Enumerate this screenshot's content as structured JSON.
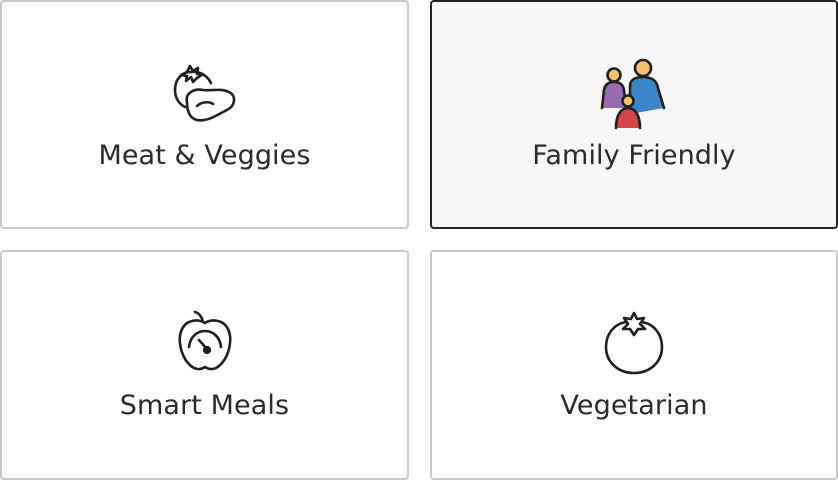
{
  "options": [
    {
      "label": "Meat & Veggies",
      "icon": "meat-veggies-icon",
      "selected": false
    },
    {
      "label": "Family Friendly",
      "icon": "family-icon",
      "selected": true
    },
    {
      "label": "Smart Meals",
      "icon": "apple-gauge-icon",
      "selected": false
    },
    {
      "label": "Vegetarian",
      "icon": "tomato-icon",
      "selected": false
    }
  ],
  "colors": {
    "border_default": "#c8c8c8",
    "border_selected": "#242424",
    "selected_background": "#f7f7f7",
    "text": "#2a2a2a",
    "family_blue": "#3a86c8",
    "family_purple": "#9b6bb0",
    "family_red": "#d64545",
    "family_skin": "#f2c46b"
  }
}
